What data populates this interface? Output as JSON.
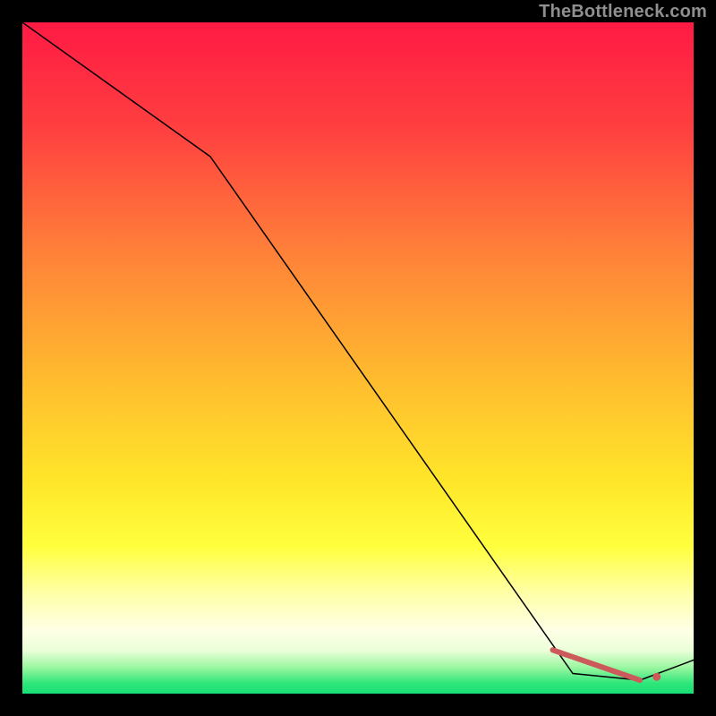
{
  "attribution": "TheBottleneck.com",
  "chart_data": {
    "type": "line",
    "title": "",
    "xlabel": "",
    "ylabel": "",
    "xlim": [
      0,
      100
    ],
    "ylim": [
      0,
      100
    ],
    "series": [
      {
        "name": "curve",
        "stroke": "#000000",
        "stroke_width": 1.5,
        "x": [
          0,
          28,
          82,
          92,
          100
        ],
        "values": [
          100,
          80,
          3,
          2,
          5
        ]
      },
      {
        "name": "highlight-segment",
        "stroke": "#cc5a5a",
        "stroke_width": 6,
        "x": [
          79,
          92
        ],
        "values": [
          6.5,
          2
        ]
      }
    ],
    "markers": [
      {
        "name": "highlight-dot",
        "x": 94.5,
        "y": 2.5,
        "r": 4.5,
        "fill": "#cc5a5a"
      }
    ],
    "background_gradient_stops": [
      {
        "pos": 0.0,
        "color": "#ff1a44"
      },
      {
        "pos": 0.16,
        "color": "#ff4040"
      },
      {
        "pos": 0.34,
        "color": "#ff8039"
      },
      {
        "pos": 0.52,
        "color": "#ffb82f"
      },
      {
        "pos": 0.68,
        "color": "#ffe52a"
      },
      {
        "pos": 0.78,
        "color": "#ffff3d"
      },
      {
        "pos": 0.85,
        "color": "#ffffa8"
      },
      {
        "pos": 0.905,
        "color": "#ffffe6"
      },
      {
        "pos": 0.935,
        "color": "#ecffda"
      },
      {
        "pos": 0.96,
        "color": "#9ef7a2"
      },
      {
        "pos": 0.985,
        "color": "#2ee67a"
      },
      {
        "pos": 1.0,
        "color": "#19df74"
      }
    ]
  }
}
